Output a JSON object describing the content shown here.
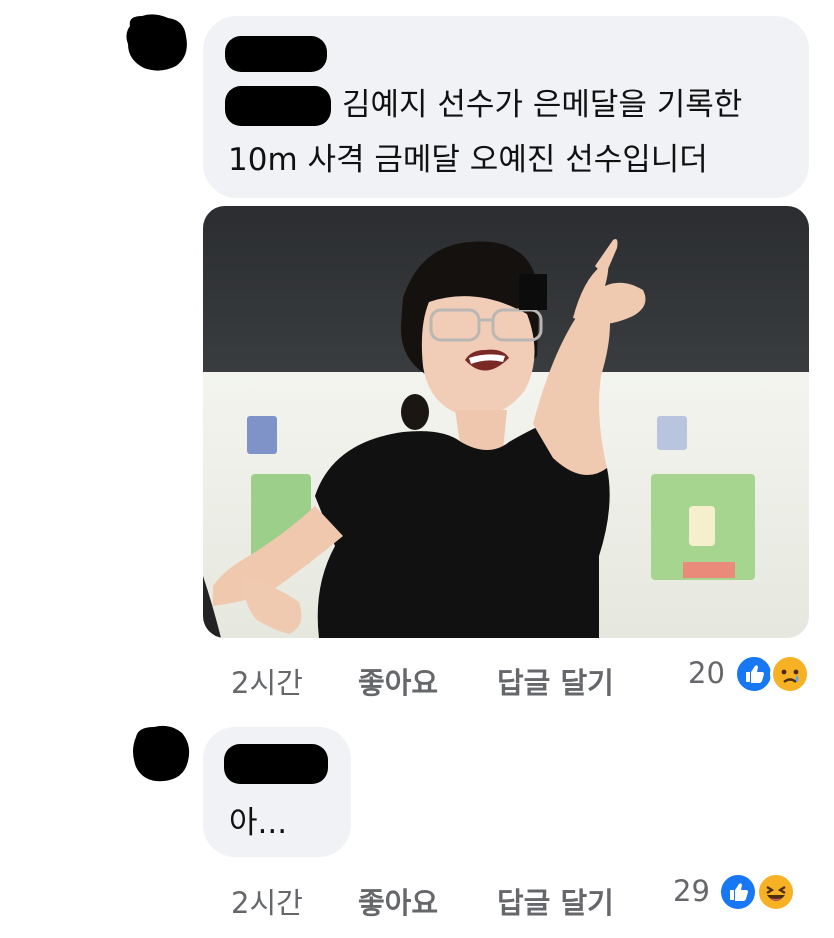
{
  "comments": [
    {
      "author": "",
      "lines": [
        "김예지 선수가 은메달을 기록한",
        "10m 사격 금메달 오예진 선수입니더"
      ],
      "time": "2시간",
      "like_label": "좋아요",
      "reply_label": "답글 달기",
      "reaction_count": "20",
      "reaction_icons": [
        "like-icon",
        "sad-icon"
      ]
    },
    {
      "author": "",
      "lines": [
        "아..."
      ],
      "time": "2시간",
      "like_label": "좋아요",
      "reply_label": "답글 달기",
      "reaction_count": "29",
      "reaction_icons": [
        "like-icon",
        "laugh-icon"
      ]
    }
  ],
  "colors": {
    "bubble": "#f0f2f5",
    "meta": "#65676b",
    "like": "#1877f2",
    "emoji": "#f7b125"
  }
}
